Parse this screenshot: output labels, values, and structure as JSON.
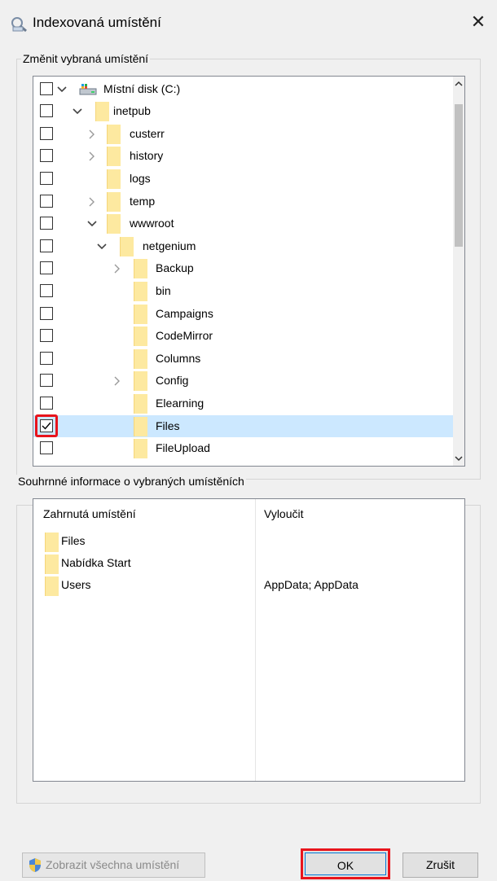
{
  "window": {
    "title": "Indexovaná umístění",
    "close_glyph": "✕"
  },
  "locations_group": {
    "label": "Změnit vybraná umístění",
    "tree": [
      {
        "label": "Místní disk (C:)",
        "indent": 0,
        "expander": "expanded",
        "icon": "drive-icon",
        "checked": false
      },
      {
        "label": "inetpub",
        "indent": 1,
        "expander": "expanded",
        "icon": "folder-icon",
        "checked": false
      },
      {
        "label": "custerr",
        "indent": 2,
        "expander": "collapsed",
        "icon": "folder-icon",
        "checked": false
      },
      {
        "label": "history",
        "indent": 2,
        "expander": "collapsed",
        "icon": "folder-icon",
        "checked": false
      },
      {
        "label": "logs",
        "indent": 2,
        "expander": "none",
        "icon": "folder-icon",
        "checked": false
      },
      {
        "label": "temp",
        "indent": 2,
        "expander": "collapsed",
        "icon": "folder-icon",
        "checked": false
      },
      {
        "label": "wwwroot",
        "indent": 2,
        "expander": "expanded",
        "icon": "folder-icon",
        "checked": false
      },
      {
        "label": "netgenium",
        "indent": 3,
        "expander": "expanded",
        "icon": "folder-icon",
        "checked": false
      },
      {
        "label": "Backup",
        "indent": 4,
        "expander": "collapsed",
        "icon": "folder-icon",
        "checked": false
      },
      {
        "label": "bin",
        "indent": 4,
        "expander": "none",
        "icon": "folder-icon",
        "checked": false
      },
      {
        "label": "Campaigns",
        "indent": 4,
        "expander": "none",
        "icon": "folder-icon",
        "checked": false
      },
      {
        "label": "CodeMirror",
        "indent": 4,
        "expander": "none",
        "icon": "folder-icon",
        "checked": false
      },
      {
        "label": "Columns",
        "indent": 4,
        "expander": "none",
        "icon": "folder-icon",
        "checked": false
      },
      {
        "label": "Config",
        "indent": 4,
        "expander": "collapsed",
        "icon": "folder-icon",
        "checked": false
      },
      {
        "label": "Elearning",
        "indent": 4,
        "expander": "none",
        "icon": "folder-icon",
        "checked": false
      },
      {
        "label": "Files",
        "indent": 4,
        "expander": "none",
        "icon": "folder-icon",
        "checked": true,
        "selected": true,
        "highlighted": true
      },
      {
        "label": "FileUpload",
        "indent": 4,
        "expander": "none",
        "icon": "folder-icon",
        "checked": false
      }
    ]
  },
  "summary_group": {
    "label": "Souhrnné informace o vybraných umístěních",
    "columns": {
      "included": "Zahrnutá umístění",
      "excluded": "Vyloučit"
    },
    "rows": [
      {
        "included": "Files",
        "excluded": ""
      },
      {
        "included": "Nabídka Start",
        "excluded": ""
      },
      {
        "included": "Users",
        "excluded": "AppData; AppData"
      }
    ]
  },
  "buttons": {
    "show_all": "Zobrazit všechna umístění",
    "ok": "OK",
    "cancel": "Zrušit"
  },
  "colors": {
    "selection": "#cce8ff",
    "highlight_red": "#e8141c",
    "folder": "#fde9a0"
  }
}
